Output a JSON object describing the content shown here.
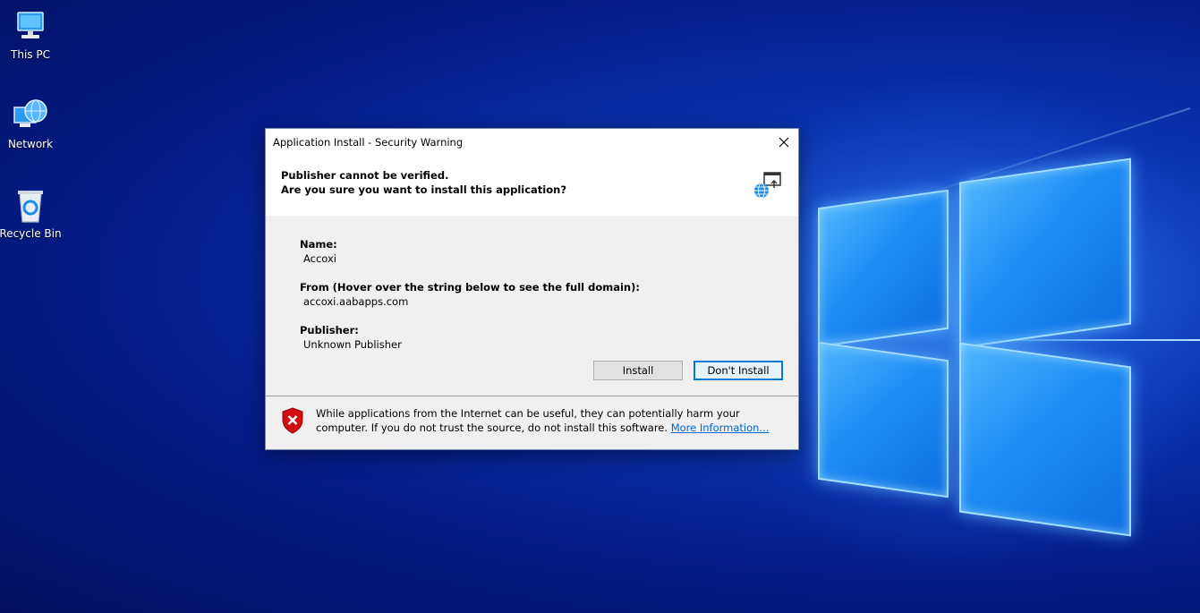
{
  "desktop": {
    "icons": [
      {
        "label": "This PC",
        "icon": "computer-icon"
      },
      {
        "label": "Network",
        "icon": "network-globe-icon"
      },
      {
        "label": "Recycle Bin",
        "icon": "recycle-bin-icon"
      }
    ]
  },
  "dialog": {
    "title": "Application Install - Security Warning",
    "header": {
      "line1": "Publisher cannot be verified.",
      "line2": "Are you sure you want to install this application?",
      "icon": "application-install-icon"
    },
    "fields": {
      "name_label": "Name:",
      "name_value": "Accoxi",
      "from_label": "From (Hover over the string below to see the full domain):",
      "from_value": "accoxi.aabapps.com",
      "publisher_label": "Publisher:",
      "publisher_value": "Unknown Publisher"
    },
    "buttons": {
      "install": "Install",
      "dont_install": "Don't Install"
    },
    "footer": {
      "warning_text": "While applications from the Internet can be useful, they can potentially harm your computer. If you do not trust the source, do not install this software.",
      "more_info_link": "More Information...",
      "icon": "security-shield-icon"
    }
  },
  "colors": {
    "link": "#0066cc",
    "focus_border": "#0078d7",
    "shield_red": "#d40d12"
  }
}
